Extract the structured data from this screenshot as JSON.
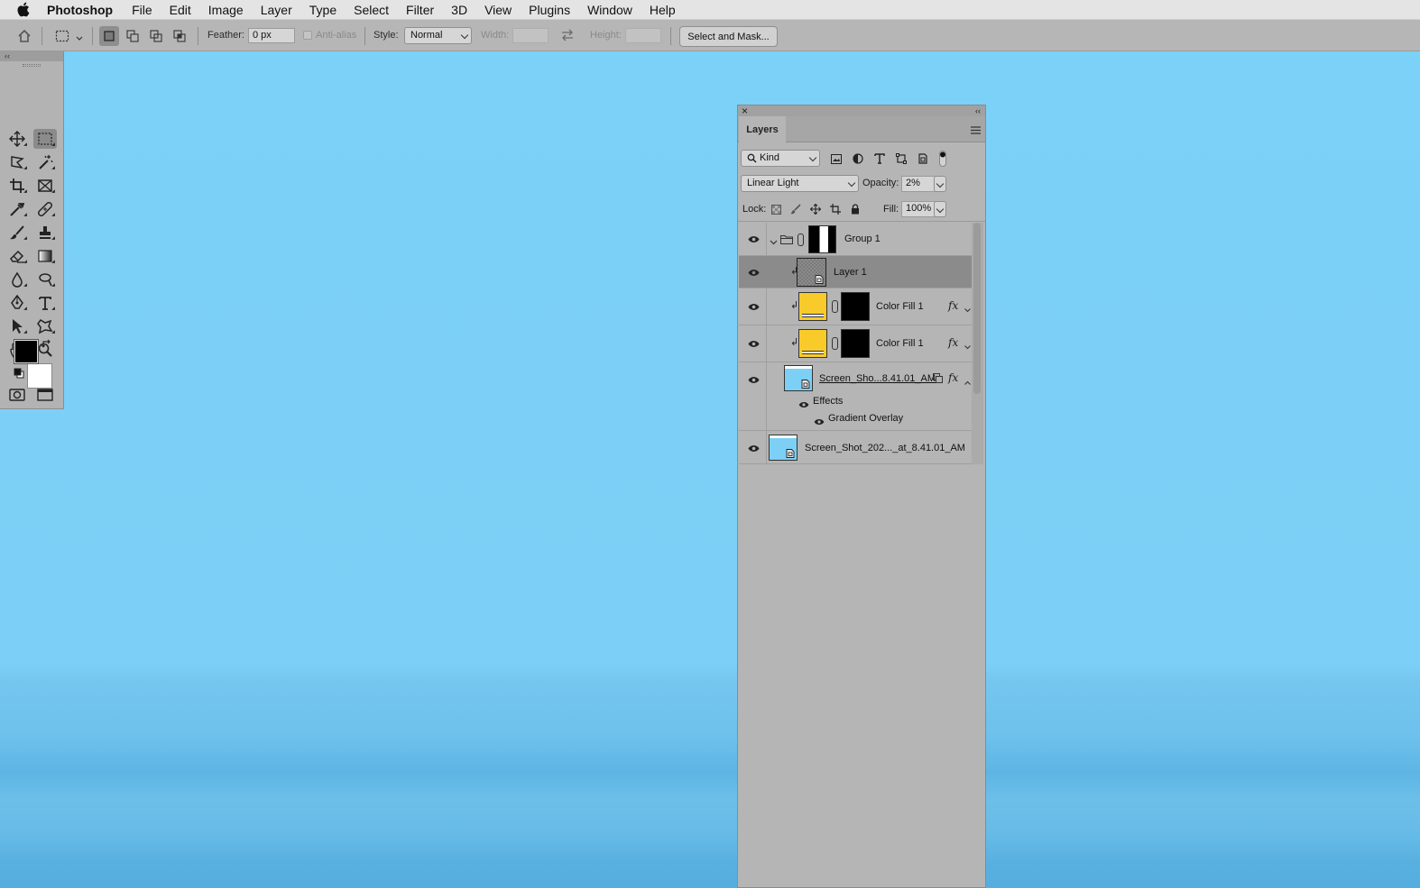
{
  "menubar": {
    "app_name": "Photoshop",
    "items": [
      "File",
      "Edit",
      "Image",
      "Layer",
      "Type",
      "Select",
      "Filter",
      "3D",
      "View",
      "Plugins",
      "Window",
      "Help"
    ]
  },
  "options_bar": {
    "feather_label": "Feather:",
    "feather_value": "0 px",
    "antialias_label": "Anti-alias",
    "style_label": "Style:",
    "style_value": "Normal",
    "width_label": "Width:",
    "height_label": "Height:",
    "select_mask_label": "Select and Mask..."
  },
  "toolbox": {
    "collapse_glyph": "‹‹",
    "more_glyph": "•••"
  },
  "layers_panel": {
    "close_glyph": "×",
    "collapse_glyph": "‹‹",
    "tab_label": "Layers",
    "filter_kind": "Kind",
    "blend_mode": "Linear Light",
    "opacity_label": "Opacity:",
    "opacity_value": "2%",
    "lock_label": "Lock:",
    "fill_label": "Fill:",
    "fill_value": "100%",
    "layers": [
      {
        "name": "Group 1"
      },
      {
        "name": "Layer 1"
      },
      {
        "name": "Color Fill 1",
        "fx": "fx"
      },
      {
        "name": "Color Fill 1",
        "fx": "fx"
      },
      {
        "name": "Screen_Sho...8.41.01_AM",
        "fx": "fx",
        "effects_label": "Effects",
        "effect_item": "Gradient Overlay"
      },
      {
        "name": "Screen_Shot_202..._at_8.41.01_AM"
      }
    ]
  },
  "colors": {
    "canvas": "#7cd0f6",
    "panel_bg": "#b5b5b5",
    "selected_row": "#8b8b8b",
    "fill_yellow": "#f9cb2a"
  }
}
